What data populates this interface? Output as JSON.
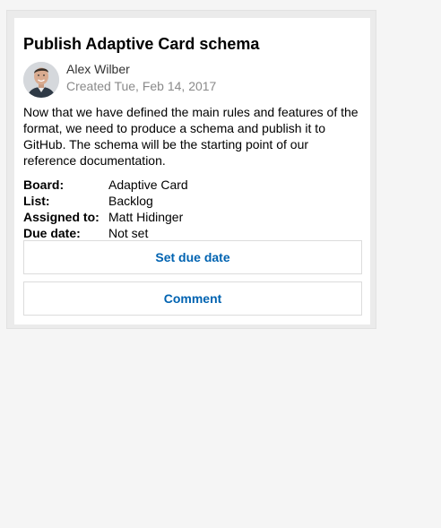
{
  "card": {
    "title": "Publish Adaptive Card schema",
    "author": "Alex Wilber",
    "created": "Created Tue, Feb 14, 2017",
    "description": "Now that we have defined the main rules and features of the format, we need to produce a schema and publish it to GitHub. The schema will be the starting point of our reference documentation.",
    "facts": [
      {
        "key": "Board:",
        "value": "Adaptive Card"
      },
      {
        "key": "List:",
        "value": "Backlog"
      },
      {
        "key": "Assigned to:",
        "value": "Matt Hidinger"
      },
      {
        "key": "Due date:",
        "value": "Not set"
      }
    ],
    "actions": [
      {
        "label": "Set due date"
      },
      {
        "label": "Comment"
      }
    ]
  },
  "colors": {
    "page_bg": "#f5f5f5",
    "card_border_bg": "#ebebeb",
    "card_bg": "#ffffff",
    "action_text": "#0063b1",
    "subtle_text": "#8a8a8a"
  }
}
